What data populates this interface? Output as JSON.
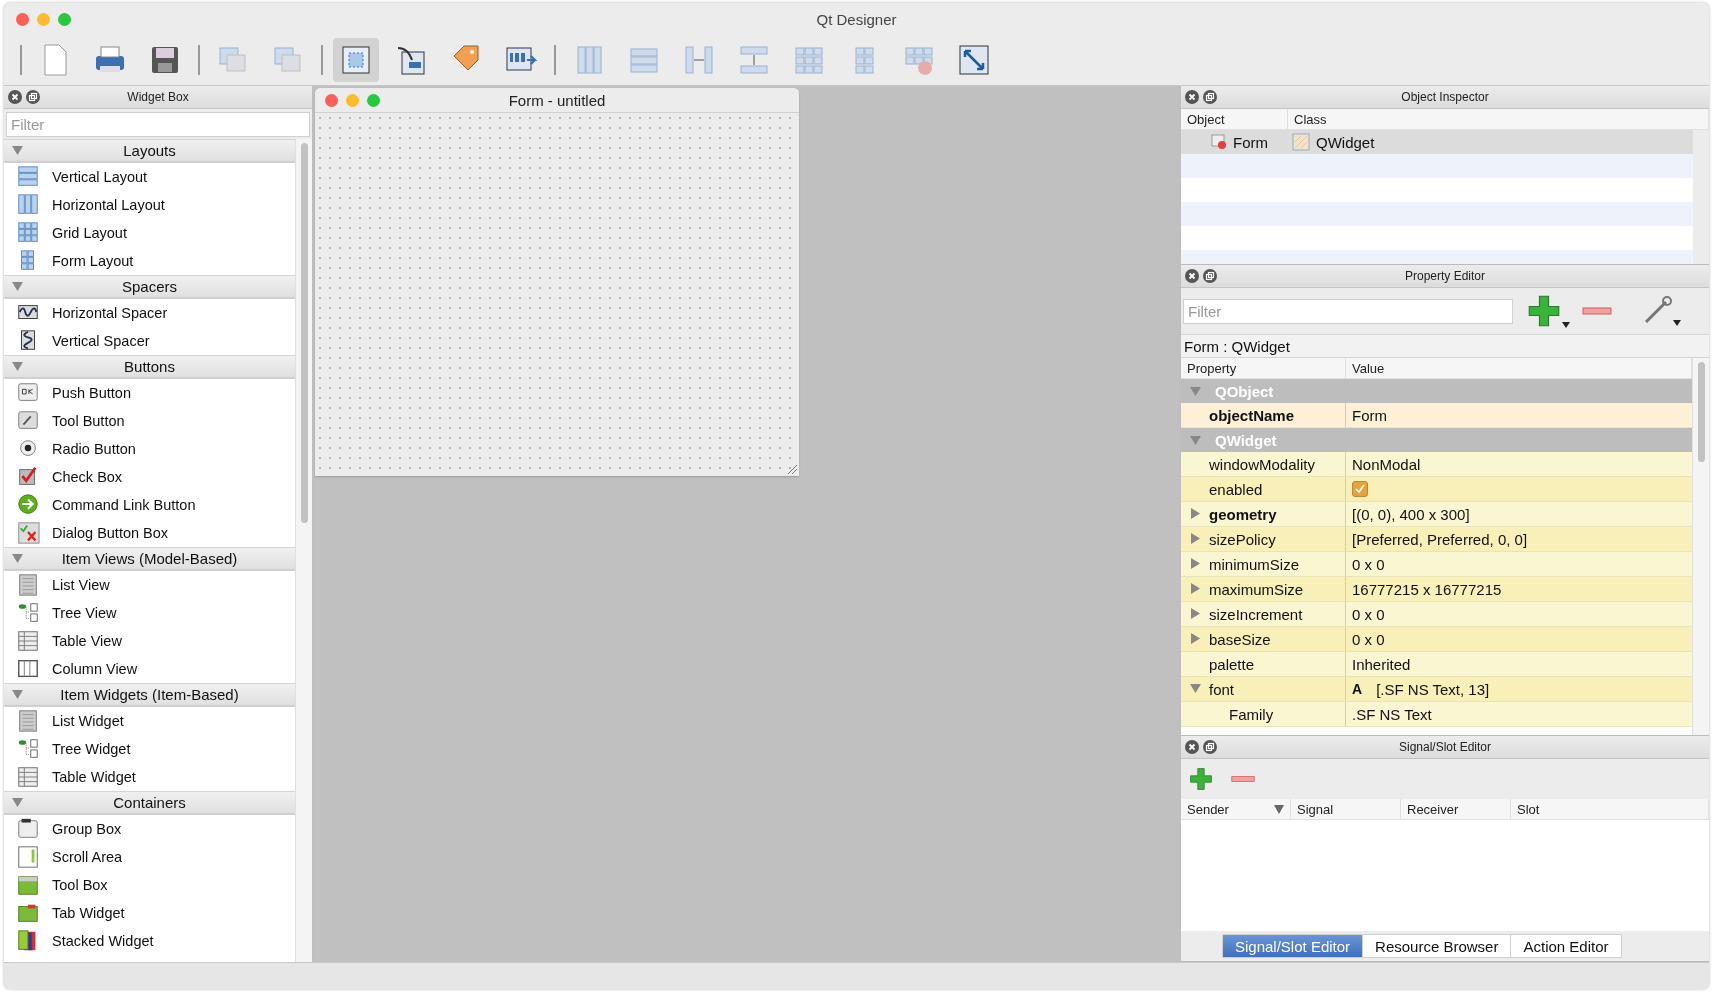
{
  "window": {
    "title": "Qt Designer"
  },
  "toolbar": {
    "groups": [
      [
        {
          "kind": "new",
          "selected": false,
          "disabled": false
        },
        {
          "kind": "print",
          "selected": false,
          "disabled": false
        },
        {
          "kind": "save",
          "selected": false,
          "disabled": false
        }
      ],
      [
        {
          "kind": "send-back",
          "selected": false,
          "disabled": true
        },
        {
          "kind": "bring-front",
          "selected": false,
          "disabled": true
        }
      ],
      [
        {
          "kind": "edit-widgets",
          "selected": true,
          "disabled": false
        },
        {
          "kind": "edit-signals",
          "selected": false,
          "disabled": false
        },
        {
          "kind": "edit-buddies",
          "selected": false,
          "disabled": false
        },
        {
          "kind": "edit-taborder",
          "selected": false,
          "disabled": false
        }
      ],
      [
        {
          "kind": "layout-h",
          "selected": false,
          "disabled": true
        },
        {
          "kind": "layout-v",
          "selected": false,
          "disabled": true
        },
        {
          "kind": "split-h",
          "selected": false,
          "disabled": true
        },
        {
          "kind": "split-v",
          "selected": false,
          "disabled": true
        },
        {
          "kind": "layout-grid",
          "selected": false,
          "disabled": true
        },
        {
          "kind": "layout-form",
          "selected": false,
          "disabled": true
        },
        {
          "kind": "break-layout",
          "selected": false,
          "disabled": true
        },
        {
          "kind": "adjust-size",
          "selected": false,
          "disabled": false
        }
      ]
    ]
  },
  "widget_box": {
    "title": "Widget Box",
    "filter_placeholder": "Filter",
    "sections": [
      {
        "title": "Layouts",
        "expanded": true,
        "items": [
          {
            "label": "Vertical Layout",
            "kind": "vlayout"
          },
          {
            "label": "Horizontal Layout",
            "kind": "hlayout"
          },
          {
            "label": "Grid Layout",
            "kind": "grid"
          },
          {
            "label": "Form Layout",
            "kind": "form"
          }
        ]
      },
      {
        "title": "Spacers",
        "expanded": true,
        "items": [
          {
            "label": "Horizontal Spacer",
            "kind": "hspacer"
          },
          {
            "label": "Vertical Spacer",
            "kind": "vspacer"
          }
        ]
      },
      {
        "title": "Buttons",
        "expanded": true,
        "items": [
          {
            "label": "Push Button",
            "kind": "push"
          },
          {
            "label": "Tool Button",
            "kind": "tool"
          },
          {
            "label": "Radio Button",
            "kind": "radio"
          },
          {
            "label": "Check Box",
            "kind": "check"
          },
          {
            "label": "Command Link Button",
            "kind": "cmdlink"
          },
          {
            "label": "Dialog Button Box",
            "kind": "dialogbox"
          }
        ]
      },
      {
        "title": "Item Views (Model-Based)",
        "expanded": true,
        "items": [
          {
            "label": "List View",
            "kind": "list"
          },
          {
            "label": "Tree View",
            "kind": "tree"
          },
          {
            "label": "Table View",
            "kind": "table"
          },
          {
            "label": "Column View",
            "kind": "column"
          }
        ]
      },
      {
        "title": "Item Widgets (Item-Based)",
        "expanded": true,
        "items": [
          {
            "label": "List Widget",
            "kind": "list"
          },
          {
            "label": "Tree Widget",
            "kind": "tree"
          },
          {
            "label": "Table Widget",
            "kind": "table"
          }
        ]
      },
      {
        "title": "Containers",
        "expanded": true,
        "items": [
          {
            "label": "Group Box",
            "kind": "groupbox"
          },
          {
            "label": "Scroll Area",
            "kind": "scroll"
          },
          {
            "label": "Tool Box",
            "kind": "toolbox"
          },
          {
            "label": "Tab Widget",
            "kind": "tab"
          },
          {
            "label": "Stacked Widget",
            "kind": "stacked"
          }
        ]
      }
    ]
  },
  "form_window": {
    "title": "Form - untitled"
  },
  "object_inspector": {
    "title": "Object Inspector",
    "columns": [
      "Object",
      "Class"
    ],
    "rows": [
      {
        "object": "Form",
        "class": "QWidget",
        "selected": true
      }
    ]
  },
  "property_editor": {
    "title": "Property Editor",
    "filter_placeholder": "Filter",
    "context": "Form : QWidget",
    "columns": [
      "Property",
      "Value"
    ],
    "rows": [
      {
        "kind": "group",
        "name": "QObject",
        "expanded": true
      },
      {
        "kind": "property",
        "name": "objectName",
        "value": "Form",
        "modified": true
      },
      {
        "kind": "group",
        "name": "QWidget",
        "expanded": true
      },
      {
        "kind": "property",
        "name": "windowModality",
        "value": "NonModal",
        "modified": false
      },
      {
        "kind": "checkbox",
        "name": "enabled",
        "checked": true,
        "modified": false
      },
      {
        "kind": "property",
        "name": "geometry",
        "value": "[(0, 0), 400 x 300]",
        "modified": true,
        "expanded": false
      },
      {
        "kind": "property",
        "name": "sizePolicy",
        "value": "[Preferred, Preferred, 0, 0]",
        "modified": false,
        "expanded": false
      },
      {
        "kind": "property",
        "name": "minimumSize",
        "value": "0 x 0",
        "modified": false,
        "expanded": false
      },
      {
        "kind": "property",
        "name": "maximumSize",
        "value": "16777215 x 16777215",
        "modified": false,
        "expanded": false
      },
      {
        "kind": "property",
        "name": "sizeIncrement",
        "value": "0 x 0",
        "modified": false,
        "expanded": false
      },
      {
        "kind": "property",
        "name": "baseSize",
        "value": "0 x 0",
        "modified": false,
        "expanded": false
      },
      {
        "kind": "property",
        "name": "palette",
        "value": "Inherited",
        "modified": false
      },
      {
        "kind": "font",
        "name": "font",
        "font_glyph": "A",
        "value": "[.SF NS Text, 13]",
        "modified": false,
        "expanded": true,
        "children": [
          {
            "name": "Family",
            "value": ".SF NS Text"
          }
        ]
      }
    ]
  },
  "signal_slot_editor": {
    "title": "Signal/Slot Editor",
    "columns": [
      {
        "label": "Sender",
        "sorted": true
      },
      {
        "label": "Signal",
        "sorted": false
      },
      {
        "label": "Receiver",
        "sorted": false
      },
      {
        "label": "Slot",
        "sorted": false
      }
    ]
  },
  "bottom_tabs": [
    {
      "label": "Signal/Slot Editor",
      "selected": true
    },
    {
      "label": "Resource Browser",
      "selected": false
    },
    {
      "label": "Action Editor",
      "selected": false
    }
  ]
}
